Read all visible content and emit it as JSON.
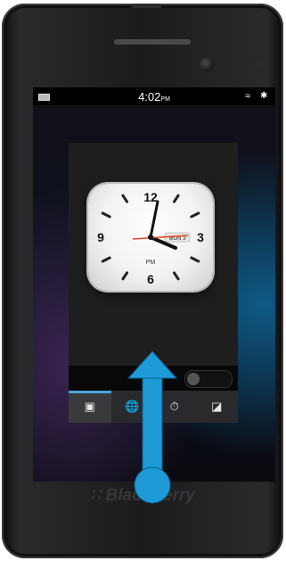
{
  "statusbar": {
    "time": "4:02",
    "time_suffix": "PM"
  },
  "clock": {
    "date_badge": "MON 3",
    "period": "PM",
    "numerals": [
      "12",
      "3",
      "6",
      "9"
    ]
  },
  "toolbar": {
    "toggle_state": "off"
  },
  "tabs": [
    {
      "icon": "alarm-icon",
      "active": true
    },
    {
      "icon": "globe-icon",
      "active": false
    },
    {
      "icon": "stopwatch-icon",
      "active": false
    },
    {
      "icon": "timer-icon",
      "active": false
    }
  ],
  "gesture": {
    "direction": "swipe-up",
    "color": "#1e9bd7"
  },
  "device": {
    "brand": "BlackBerry"
  },
  "colors": {
    "accent": "#4aa3d8",
    "second_hand": "#e4401e"
  }
}
